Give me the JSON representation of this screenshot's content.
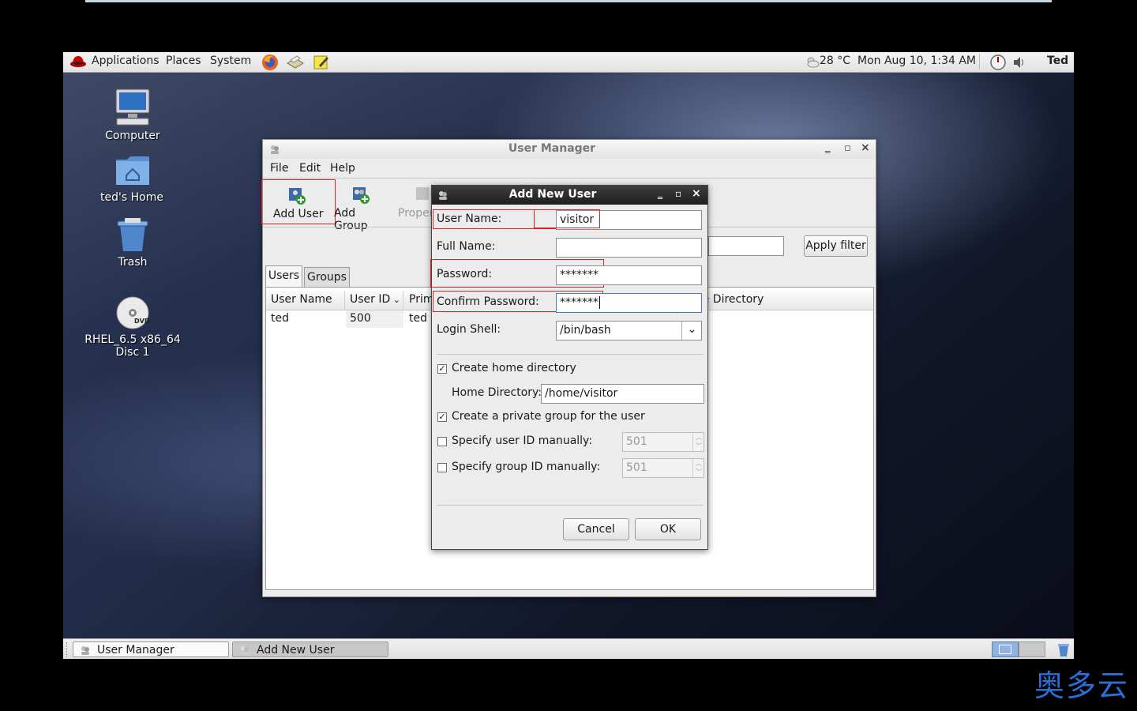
{
  "panel": {
    "menus": [
      "Applications",
      "Places",
      "System"
    ],
    "weather": "28 °C",
    "clock": "Mon Aug 10,  1:34 AM",
    "user": "Ted"
  },
  "desktop": {
    "icons": [
      "Computer",
      "ted's Home",
      "Trash",
      "RHEL_6.5 x86_64",
      "Disc 1"
    ],
    "dvd_badge": "DVD"
  },
  "user_manager": {
    "title": "User Manager",
    "menus": [
      "File",
      "Edit",
      "Help"
    ],
    "toolbar": [
      "Add User",
      "Add Group",
      "Properties"
    ],
    "apply_filter": "Apply filter",
    "tabs": [
      "Users",
      "Groups"
    ],
    "columns": [
      "User Name",
      "User ID",
      "Primary Group",
      "Home Directory"
    ],
    "rows": [
      {
        "name": "ted",
        "id": "500",
        "group": "ted"
      }
    ]
  },
  "dialog": {
    "title": "Add New User",
    "labels": {
      "username": "User Name:",
      "fullname": "Full Name:",
      "password": "Password:",
      "confirm": "Confirm Password:",
      "shell": "Login Shell:",
      "create_home": "Create home directory",
      "home_dir": "Home Directory:",
      "private_group": "Create a private group for the user",
      "uid_manual": "Specify user ID manually:",
      "gid_manual": "Specify group ID manually:"
    },
    "values": {
      "username": "visitor",
      "fullname": "",
      "password": "*******",
      "confirm": "*******",
      "shell": "/bin/bash",
      "home_dir": "/home/visitor",
      "uid": "501",
      "gid": "501"
    },
    "checks": {
      "create_home": true,
      "private_group": true,
      "uid_manual": false,
      "gid_manual": false
    },
    "cancel": "Cancel",
    "ok": "OK"
  },
  "taskbar": [
    "User Manager",
    "Add New User"
  ],
  "watermark": "奥多云"
}
